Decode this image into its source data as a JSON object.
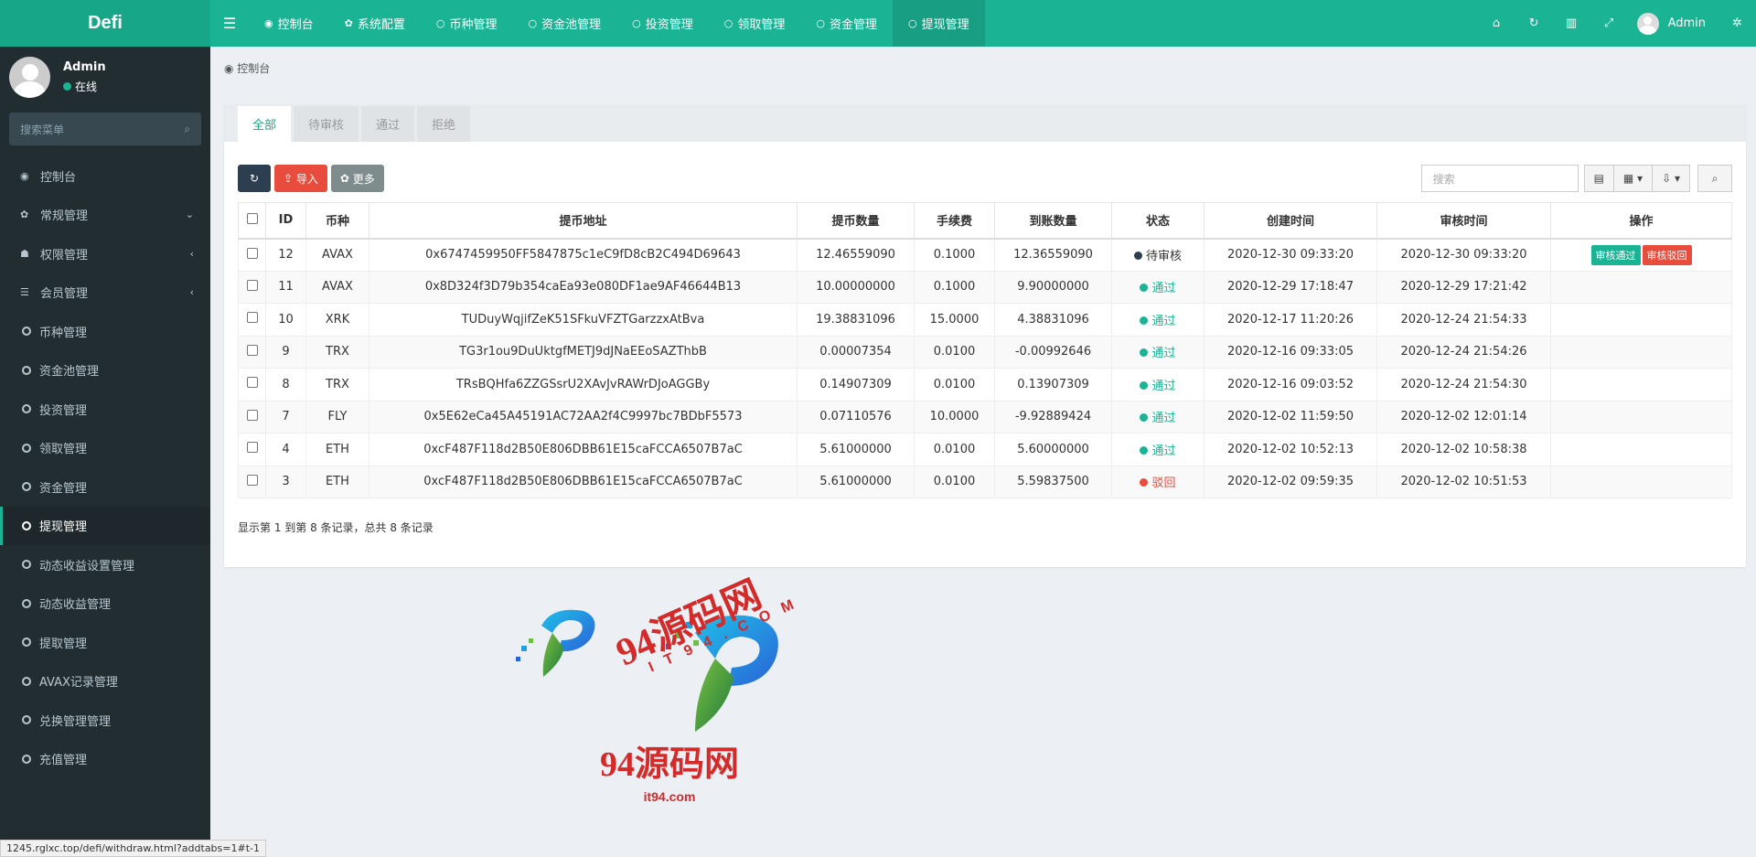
{
  "brand": "Defi",
  "header": {
    "tabs": [
      {
        "icon": "dashboard-icon",
        "glyph": "◉",
        "label": "控制台"
      },
      {
        "icon": "gear-icon",
        "glyph": "✿",
        "label": "系统配置"
      },
      {
        "icon": "circle-icon",
        "glyph": "○",
        "label": "币种管理"
      },
      {
        "icon": "circle-icon",
        "glyph": "○",
        "label": "资金池管理"
      },
      {
        "icon": "circle-icon",
        "glyph": "○",
        "label": "投资管理"
      },
      {
        "icon": "circle-icon",
        "glyph": "○",
        "label": "领取管理"
      },
      {
        "icon": "circle-icon",
        "glyph": "○",
        "label": "资金管理"
      },
      {
        "icon": "circle-icon",
        "glyph": "○",
        "label": "提现管理"
      }
    ],
    "active_tab": 7,
    "user_name": "Admin"
  },
  "sidebar": {
    "user_name": "Admin",
    "status": "在线",
    "search_placeholder": "搜索菜单",
    "items": [
      {
        "label": "控制台",
        "icon": "dashboard-icon",
        "glyph": "◉",
        "chev": ""
      },
      {
        "label": "常规管理",
        "icon": "cogs-icon",
        "glyph": "✿",
        "chev": "⌄"
      },
      {
        "label": "权限管理",
        "icon": "group-icon",
        "glyph": "☗",
        "chev": "‹"
      },
      {
        "label": "会员管理",
        "icon": "list-icon",
        "glyph": "☰",
        "chev": "‹"
      },
      {
        "label": "币种管理",
        "icon": "circle-icon",
        "glyph": "",
        "chev": ""
      },
      {
        "label": "资金池管理",
        "icon": "circle-icon",
        "glyph": "",
        "chev": ""
      },
      {
        "label": "投资管理",
        "icon": "circle-icon",
        "glyph": "",
        "chev": ""
      },
      {
        "label": "领取管理",
        "icon": "circle-icon",
        "glyph": "",
        "chev": ""
      },
      {
        "label": "资金管理",
        "icon": "circle-icon",
        "glyph": "",
        "chev": ""
      },
      {
        "label": "提现管理",
        "icon": "circle-icon",
        "glyph": "",
        "chev": ""
      },
      {
        "label": "动态收益设置管理",
        "icon": "circle-icon",
        "glyph": "",
        "chev": ""
      },
      {
        "label": "动态收益管理",
        "icon": "circle-icon",
        "glyph": "",
        "chev": ""
      },
      {
        "label": "提取管理",
        "icon": "circle-icon",
        "glyph": "",
        "chev": ""
      },
      {
        "label": "AVAX记录管理",
        "icon": "circle-icon",
        "glyph": "",
        "chev": ""
      },
      {
        "label": "兑换管理管理",
        "icon": "circle-icon",
        "glyph": "",
        "chev": ""
      },
      {
        "label": "充值管理",
        "icon": "circle-icon",
        "glyph": "",
        "chev": ""
      }
    ],
    "active_item": 9
  },
  "breadcrumb": "控制台",
  "panel": {
    "tabs": [
      "全部",
      "待审核",
      "通过",
      "拒绝"
    ],
    "active_tab": 0,
    "toolbar": {
      "import_label": "导入",
      "more_label": "更多"
    },
    "search_placeholder": "搜索",
    "columns": [
      "",
      "ID",
      "币种",
      "提币地址",
      "提币数量",
      "手续费",
      "到账数量",
      "状态",
      "创建时间",
      "审核时间",
      "操作"
    ],
    "rows": [
      {
        "id": "12",
        "coin": "AVAX",
        "address": "0x6747459950FF5847875c1eC9fD8cB2C494D69643",
        "amount": "12.46559090",
        "fee": "0.1000",
        "received": "12.36559090",
        "status": "待审核",
        "status_type": "pending",
        "created": "2020-12-30 09:33:20",
        "reviewed": "2020-12-30 09:33:20",
        "actions": [
          "审核通过",
          "审核驳回"
        ]
      },
      {
        "id": "11",
        "coin": "AVAX",
        "address": "0x8D324f3D79b354caEa93e080DF1ae9AF46644B13",
        "amount": "10.00000000",
        "fee": "0.1000",
        "received": "9.90000000",
        "status": "通过",
        "status_type": "pass",
        "created": "2020-12-29 17:18:47",
        "reviewed": "2020-12-29 17:21:42",
        "actions": []
      },
      {
        "id": "10",
        "coin": "XRK",
        "address": "TUDuyWqjifZeK51SFkuVFZTGarzzxAtBva",
        "amount": "19.38831096",
        "fee": "15.0000",
        "received": "4.38831096",
        "status": "通过",
        "status_type": "pass",
        "created": "2020-12-17 11:20:26",
        "reviewed": "2020-12-24 21:54:33",
        "actions": []
      },
      {
        "id": "9",
        "coin": "TRX",
        "address": "TG3r1ou9DuUktgfMETJ9dJNaEEoSAZThbB",
        "amount": "0.00007354",
        "fee": "0.0100",
        "received": "-0.00992646",
        "status": "通过",
        "status_type": "pass",
        "created": "2020-12-16 09:33:05",
        "reviewed": "2020-12-24 21:54:26",
        "actions": []
      },
      {
        "id": "8",
        "coin": "TRX",
        "address": "TRsBQHfa6ZZGSsrU2XAvJvRAWrDJoAGGBy",
        "amount": "0.14907309",
        "fee": "0.0100",
        "received": "0.13907309",
        "status": "通过",
        "status_type": "pass",
        "created": "2020-12-16 09:03:52",
        "reviewed": "2020-12-24 21:54:30",
        "actions": []
      },
      {
        "id": "7",
        "coin": "FLY",
        "address": "0x5E62eCa45A45191AC72AA2f4C9997bc7BDbF5573",
        "amount": "0.07110576",
        "fee": "10.0000",
        "received": "-9.92889424",
        "status": "通过",
        "status_type": "pass",
        "created": "2020-12-02 11:59:50",
        "reviewed": "2020-12-02 12:01:14",
        "actions": []
      },
      {
        "id": "4",
        "coin": "ETH",
        "address": "0xcF487F118d2B50E806DBB61E15caFCCA6507B7aC",
        "amount": "5.61000000",
        "fee": "0.0100",
        "received": "5.60000000",
        "status": "通过",
        "status_type": "pass",
        "created": "2020-12-02 10:52:13",
        "reviewed": "2020-12-02 10:58:38",
        "actions": []
      },
      {
        "id": "3",
        "coin": "ETH",
        "address": "0xcF487F118d2B50E806DBB61E15caFCCA6507B7aC",
        "amount": "5.61000000",
        "fee": "0.0100",
        "received": "5.59837500",
        "status": "驳回",
        "status_type": "reject",
        "created": "2020-12-02 09:59:35",
        "reviewed": "2020-12-02 10:51:53",
        "actions": []
      }
    ],
    "page_info": "显示第 1 到第 8 条记录，总共 8 条记录"
  },
  "watermark": {
    "top_text": "94源码网",
    "domain_caps": "IT94.COM",
    "bottom_text": "94源码网",
    "bottom_domain": "it94.com"
  },
  "status_url": "1245.rglxc.top/defi/withdraw.html?addtabs=1#t-1",
  "colors": {
    "primary": "#1ab394",
    "sidebar": "#222d32",
    "danger": "#e74c3c",
    "pending": "#2c3e50"
  }
}
